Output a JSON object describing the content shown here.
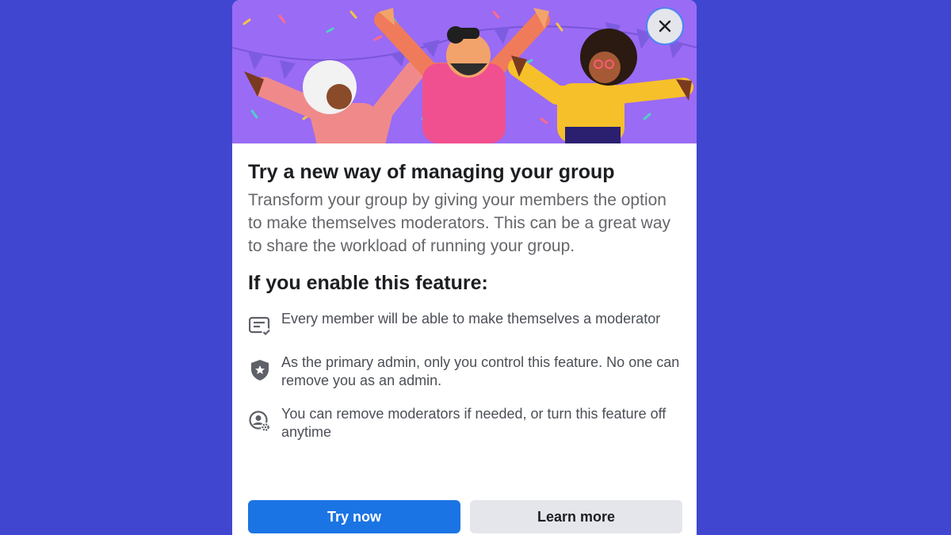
{
  "dialog": {
    "title": "Try a new way of managing your group",
    "description": "Transform your group by giving your members the option to make themselves moderators. This can be a great way to share the workload of running your group.",
    "subtitle": "If you enable this feature:",
    "close_icon": "close-icon",
    "features": [
      {
        "icon": "checklist-icon",
        "text": "Every member will be able to make themselves a moderator"
      },
      {
        "icon": "shield-star-icon",
        "text": "As the primary admin, only you control this feature. No one can remove you as an admin."
      },
      {
        "icon": "person-gear-icon",
        "text": "You can remove moderators if needed, or turn this feature off anytime"
      }
    ],
    "primary_button": "Try now",
    "secondary_button": "Learn more"
  },
  "colors": {
    "page_background": "#4046cf",
    "hero_background": "#9a6bf5",
    "primary": "#1b74e4",
    "secondary": "#e4e6eb"
  }
}
